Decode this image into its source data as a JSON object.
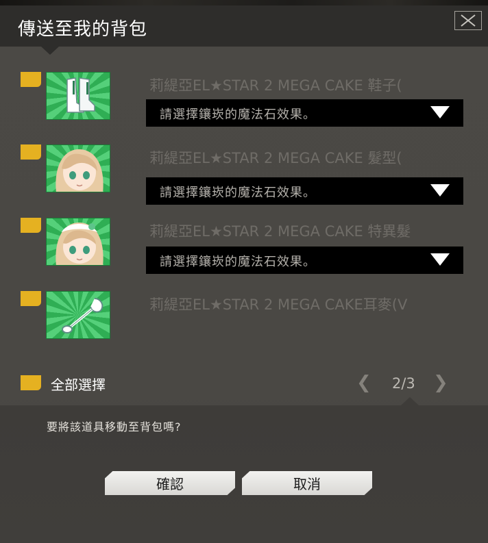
{
  "dialog": {
    "title": "傳送至我的背包",
    "close_glyph": "✕"
  },
  "items": [
    {
      "name": "莉緹亞EL★STAR 2 MEGA CAKE 鞋子(",
      "icon": "boots-icon",
      "has_select": true,
      "select_placeholder": "請選擇鑲崁的魔法石效果。"
    },
    {
      "name": "莉緹亞EL★STAR 2 MEGA CAKE 髮型(",
      "icon": "hairstyle-icon",
      "has_select": true,
      "select_placeholder": "請選擇鑲崁的魔法石效果。"
    },
    {
      "name": "莉緹亞EL★STAR 2 MEGA CAKE 特異髮",
      "icon": "special-hair-icon",
      "has_select": true,
      "select_placeholder": "請選擇鑲崁的魔法石效果。"
    },
    {
      "name": "莉緹亞EL★STAR 2 MEGA CAKE耳麥(V",
      "icon": "headset-icon",
      "has_select": false
    }
  ],
  "select_all": {
    "label": "全部選擇"
  },
  "pager": {
    "prev": "❮",
    "page": "2/3",
    "next": "❯"
  },
  "confirm": {
    "question": "要將該道具移動至背包嗎?",
    "ok_label": "確認",
    "cancel_label": "取消"
  },
  "colors": {
    "checkbox": "#e5b121",
    "icon_bg": "#2fae54",
    "title_bar": "#2e2d2b"
  }
}
